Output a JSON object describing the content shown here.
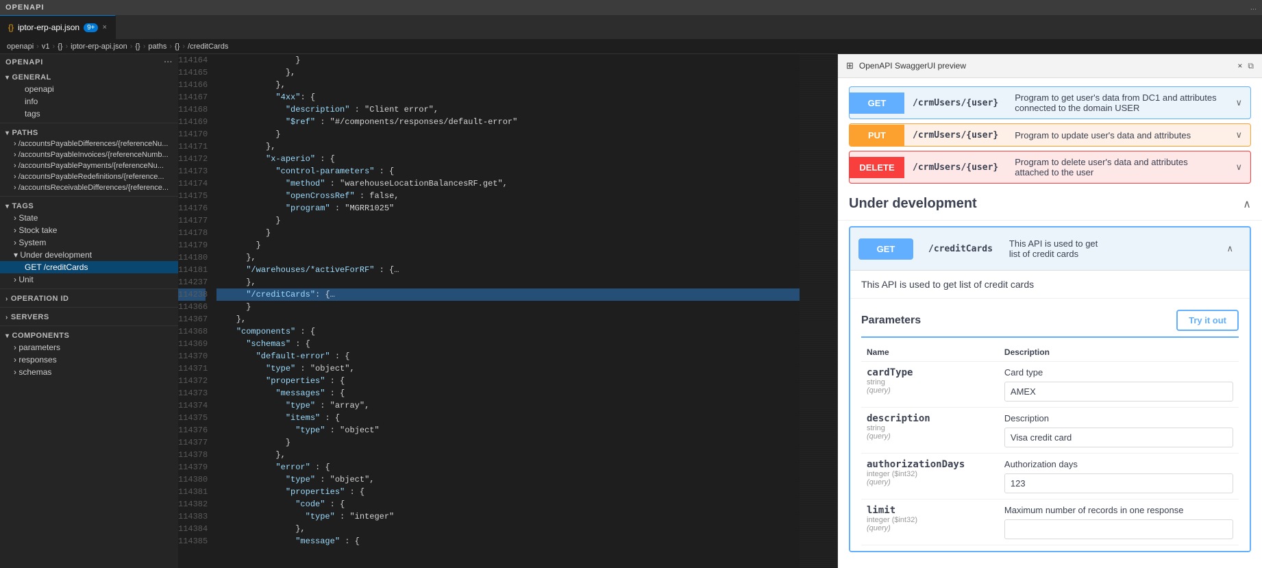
{
  "app": {
    "title": "OPENAPI",
    "top_bar_dots": "..."
  },
  "tabs": [
    {
      "label": "iptor-erp-api.json",
      "badge": "9+",
      "active": false,
      "icon": "{}"
    },
    {
      "label": "",
      "active": false
    }
  ],
  "breadcrumb": {
    "parts": [
      "openapi",
      "v1",
      "{}",
      "iptor-erp-api.json",
      "{}",
      "paths",
      "{}",
      "/creditCards"
    ]
  },
  "sidebar": {
    "header": "OPENAPI",
    "sections": {
      "general": {
        "title": "GENERAL",
        "items": [
          "openapi",
          "info",
          "tags"
        ]
      },
      "paths": {
        "title": "PATHS",
        "items": [
          "/accountsPayableDifferences/{referenceNu...",
          "/accountsPayableInvoices/{referenceNumb...",
          "/accountsPayablePayments/{referenceNu...",
          "/accountsPayableRedefinitions/{reference...",
          "/accountsReceivableDifferences/{reference..."
        ]
      },
      "tags": {
        "title": "TAGS",
        "items": [
          "State",
          "Stock take",
          "System",
          "Under development",
          "Unit"
        ],
        "active_parent": "Under development",
        "active_child": "GET /creditCards"
      },
      "operation_id": {
        "title": "OPERATION ID"
      },
      "components": {
        "title": "COMPONENTS",
        "items": [
          "parameters",
          "responses",
          "schemas"
        ]
      },
      "servers": {
        "title": "SERVERS"
      }
    }
  },
  "editor": {
    "filename": "iptor-erp-api.json",
    "lines": [
      {
        "num": "114164",
        "content": "                }",
        "highlighted": false
      },
      {
        "num": "114165",
        "content": "              },",
        "highlighted": false
      },
      {
        "num": "114166",
        "content": "            },",
        "highlighted": false
      },
      {
        "num": "114167",
        "content": "            \"4xx\": {",
        "highlighted": false
      },
      {
        "num": "114168",
        "content": "              \"description\" : \"Client error\",",
        "highlighted": false
      },
      {
        "num": "114169",
        "content": "              \"$ref\" : \"#/components/responses/default-error\"",
        "highlighted": false
      },
      {
        "num": "114170",
        "content": "            }",
        "highlighted": false
      },
      {
        "num": "114171",
        "content": "          },",
        "highlighted": false
      },
      {
        "num": "114172",
        "content": "          \"x-aperio\" : {",
        "highlighted": false
      },
      {
        "num": "114173",
        "content": "            \"control-parameters\" : {",
        "highlighted": false
      },
      {
        "num": "114174",
        "content": "              \"method\" : \"warehouseLocationBalancesRF.get\",",
        "highlighted": false
      },
      {
        "num": "114175",
        "content": "              \"openCrossRef\" : false,",
        "highlighted": false
      },
      {
        "num": "114176",
        "content": "              \"program\" : \"MGRR1025\"",
        "highlighted": false
      },
      {
        "num": "114177",
        "content": "            }",
        "highlighted": false
      },
      {
        "num": "114178",
        "content": "          }",
        "highlighted": false
      },
      {
        "num": "114179",
        "content": "        }",
        "highlighted": false
      },
      {
        "num": "114180",
        "content": "      },",
        "highlighted": false
      },
      {
        "num": "114181",
        "content": "      \"/warehouses/*activeForRF\" : {…",
        "highlighted": false
      },
      {
        "num": "114237",
        "content": "      },",
        "highlighted": false
      },
      {
        "num": "114238",
        "content": "      \"/creditCards\": {…",
        "highlighted": true
      },
      {
        "num": "114366",
        "content": "      }",
        "highlighted": false
      },
      {
        "num": "114367",
        "content": "    },",
        "highlighted": false
      },
      {
        "num": "114368",
        "content": "    \"components\" : {",
        "highlighted": false
      },
      {
        "num": "114369",
        "content": "      \"schemas\" : {",
        "highlighted": false
      },
      {
        "num": "114370",
        "content": "        \"default-error\" : {",
        "highlighted": false
      },
      {
        "num": "114371",
        "content": "          \"type\" : \"object\",",
        "highlighted": false
      },
      {
        "num": "114372",
        "content": "          \"properties\" : {",
        "highlighted": false
      },
      {
        "num": "114373",
        "content": "            \"messages\" : {",
        "highlighted": false
      },
      {
        "num": "114374",
        "content": "              \"type\" : \"array\",",
        "highlighted": false
      },
      {
        "num": "114375",
        "content": "              \"items\" : {",
        "highlighted": false
      },
      {
        "num": "114376",
        "content": "                \"type\" : \"object\"",
        "highlighted": false
      },
      {
        "num": "114377",
        "content": "              }",
        "highlighted": false
      },
      {
        "num": "114378",
        "content": "            },",
        "highlighted": false
      },
      {
        "num": "114379",
        "content": "            \"error\" : {",
        "highlighted": false
      },
      {
        "num": "114380",
        "content": "              \"type\" : \"object\",",
        "highlighted": false
      },
      {
        "num": "114381",
        "content": "              \"properties\" : {",
        "highlighted": false
      },
      {
        "num": "114382",
        "content": "                \"code\" : {",
        "highlighted": false
      },
      {
        "num": "114383",
        "content": "                  \"type\" : \"integer\"",
        "highlighted": false
      },
      {
        "num": "114384",
        "content": "                },",
        "highlighted": false
      },
      {
        "num": "114385",
        "content": "                \"message\" : {",
        "highlighted": false
      }
    ]
  },
  "preview": {
    "title": "OpenAPI SwaggerUI preview",
    "methods": [
      {
        "type": "GET",
        "path": "/crmUsers/{user}",
        "description": "Program to get user's data from DC1 and attributes connected to the domain USER",
        "expanded": false
      },
      {
        "type": "PUT",
        "path": "/crmUsers/{user}",
        "description": "Program to update user's data and attributes",
        "expanded": false
      },
      {
        "type": "DELETE",
        "path": "/crmUsers/{user}",
        "description": "Program to delete user's data and attributes attached to the user",
        "expanded": false
      }
    ],
    "under_development": {
      "title": "Under development",
      "expanded": true,
      "creditcards": {
        "method": "GET",
        "path": "/creditCards",
        "description": "This API is used to get list of credit cards",
        "body_description": "This API is used to get list of credit cards",
        "parameters_title": "Parameters",
        "try_it_out_label": "Try it out",
        "col_name": "Name",
        "col_description": "Description",
        "params": [
          {
            "name": "cardType",
            "type": "string",
            "location": "(query)",
            "description": "Card type",
            "placeholder": "AMEX"
          },
          {
            "name": "description",
            "type": "string",
            "location": "(query)",
            "description": "Description",
            "placeholder": "Visa credit card"
          },
          {
            "name": "authorizationDays",
            "type": "integer ($int32)",
            "location": "(query)",
            "description": "Authorization days",
            "placeholder": "123"
          },
          {
            "name": "limit",
            "type": "integer ($int32)",
            "location": "(query)",
            "description": "Maximum number of records in one response",
            "placeholder": ""
          }
        ]
      }
    }
  }
}
